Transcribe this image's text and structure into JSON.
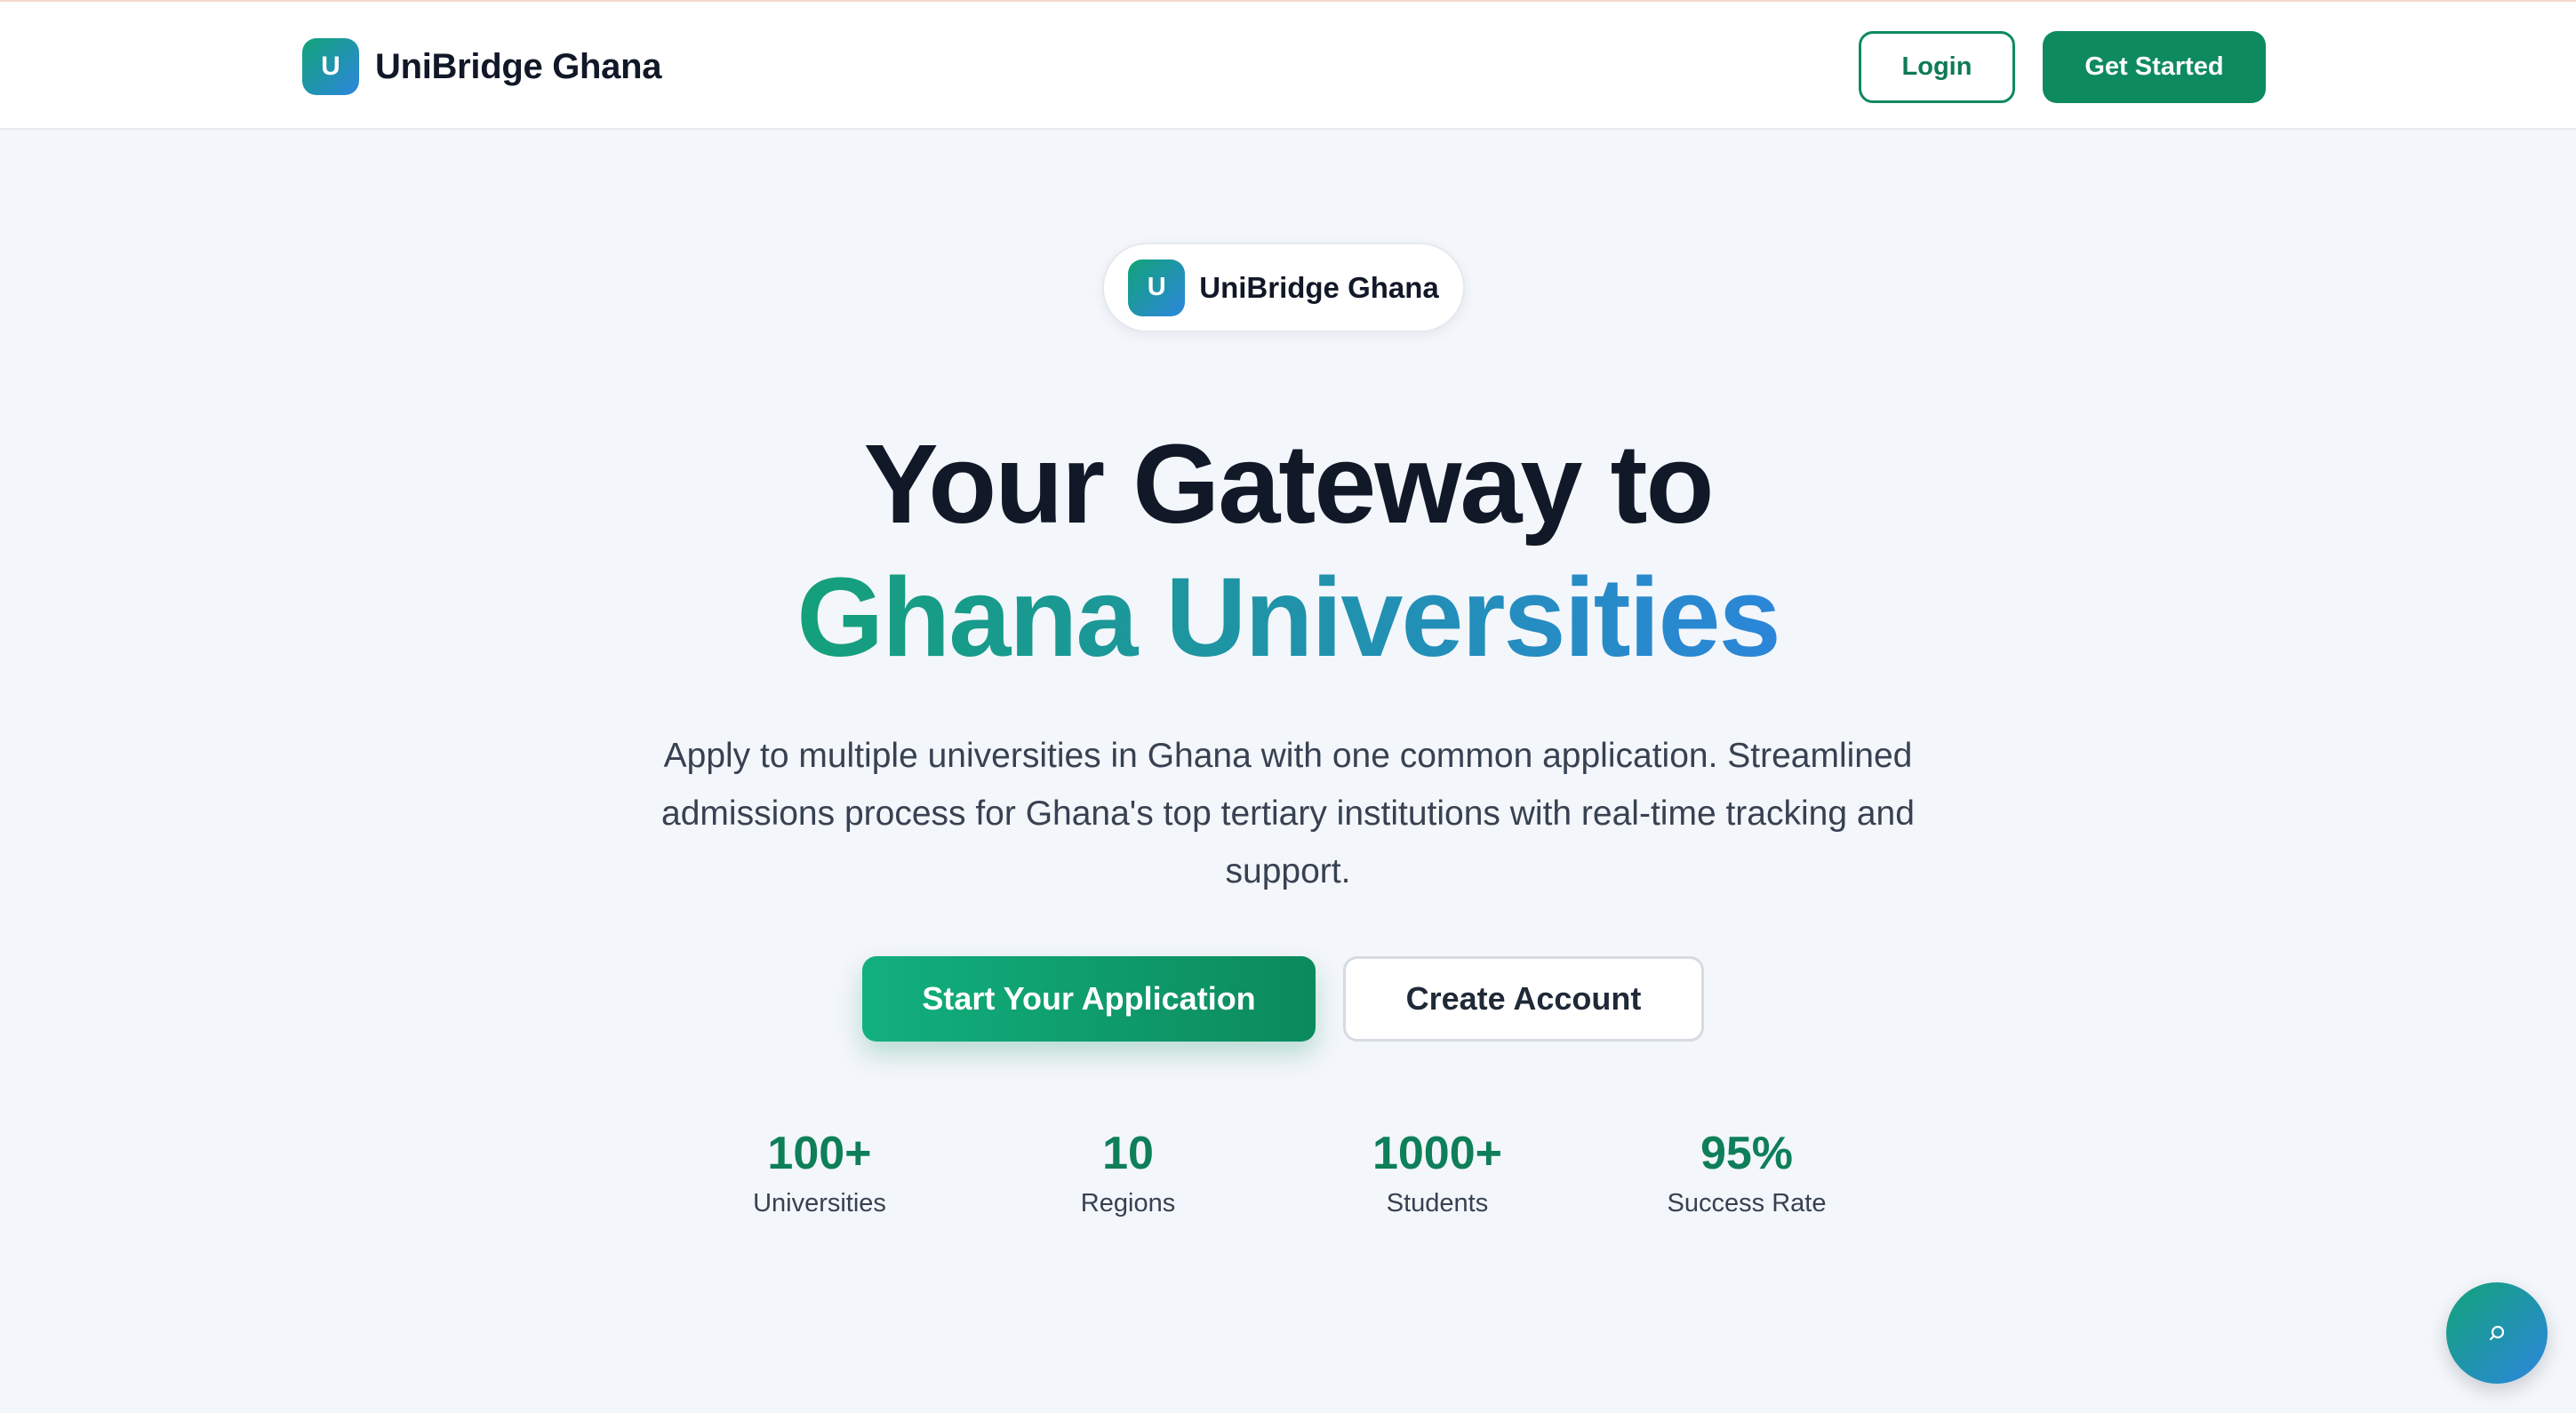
{
  "header": {
    "logo_letter": "U",
    "brand_name": "UniBridge Ghana",
    "login_label": "Login",
    "get_started_label": "Get Started"
  },
  "hero": {
    "badge_logo_letter": "U",
    "badge_text": "UniBridge Ghana",
    "headline_line1": "Your Gateway to",
    "headline_line2": "Ghana Universities",
    "subtitle": "Apply to multiple universities in Ghana with one common application. Streamlined admissions process for Ghana's top tertiary institutions with real-time tracking and support.",
    "primary_cta": "Start Your Application",
    "secondary_cta": "Create Account"
  },
  "stats": [
    {
      "value": "100+",
      "label": "Universities"
    },
    {
      "value": "10",
      "label": "Regions"
    },
    {
      "value": "1000+",
      "label": "Students"
    },
    {
      "value": "95%",
      "label": "Success Rate"
    }
  ],
  "chat": {
    "icon": "chat-icon"
  },
  "colors": {
    "brand_green": "#0e8a5f",
    "gradient_start": "#12a378",
    "gradient_end": "#2d86de",
    "page_bg": "#f3f6fa"
  }
}
